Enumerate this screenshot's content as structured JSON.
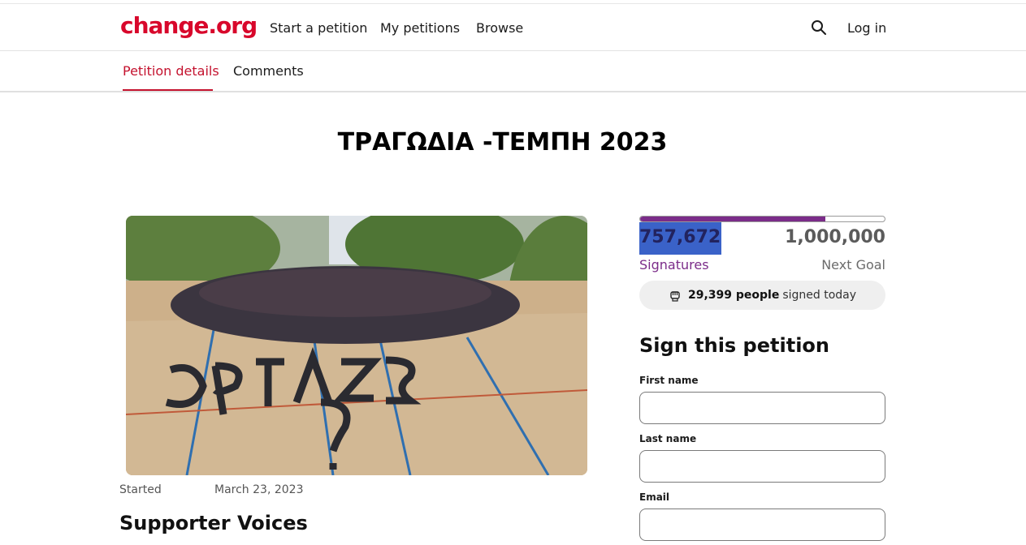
{
  "header": {
    "logo": "change.org",
    "nav": [
      "Start a petition",
      "My petitions",
      "Browse"
    ],
    "login": "Log in"
  },
  "tabs": [
    "Petition details",
    "Comments"
  ],
  "petition": {
    "title": "ΤΡΑΓΩΔΙΑ -ΤΕΜΠΗ 2023",
    "started_label": "Started",
    "started_date": "March 23, 2023",
    "supporter_voices": "Supporter Voices"
  },
  "signatures": {
    "count": "757,672",
    "goal": "1,000,000",
    "count_label": "Signatures",
    "goal_label": "Next Goal",
    "progress_fraction": 0.757672,
    "today_count": "29,399 people",
    "today_text": "signed today"
  },
  "form": {
    "heading": "Sign this petition",
    "first_name_label": "First name",
    "last_name_label": "Last name",
    "email_label": "Email"
  },
  "colors": {
    "brand": "#d8072b",
    "accent": "#7b2c89",
    "active_tab": "#c4122e"
  }
}
